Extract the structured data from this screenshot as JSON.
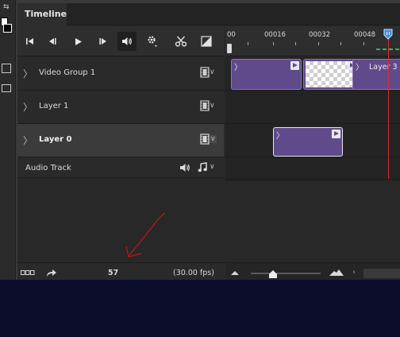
{
  "panel": {
    "tab_label": "Timeline"
  },
  "controls": {
    "icons": [
      "go-to-first-frame-icon",
      "previous-frame-icon",
      "play-icon",
      "next-frame-icon",
      "audio-icon",
      "gear-icon",
      "scissors-icon",
      "transition-icon"
    ]
  },
  "ruler": {
    "ticks": [
      "00",
      "00016",
      "00032",
      "00048"
    ]
  },
  "layers": [
    {
      "name": "Video Group 1",
      "bold": false,
      "selected": false
    },
    {
      "name": "Layer 1",
      "bold": false,
      "selected": false
    },
    {
      "name": "Layer 0",
      "bold": true,
      "selected": true
    }
  ],
  "audio_track": {
    "label": "Audio Track"
  },
  "clip_labels": {
    "layer3": "Layer 3"
  },
  "bottom": {
    "current_frame": "57",
    "fps": "(30.00 fps)"
  },
  "colors": {
    "clip": "#5f4a8c",
    "playhead": "#e02a2a",
    "panel_bg": "#282828",
    "selected_row": "#3b3b3b",
    "annotation": "#d01818"
  }
}
